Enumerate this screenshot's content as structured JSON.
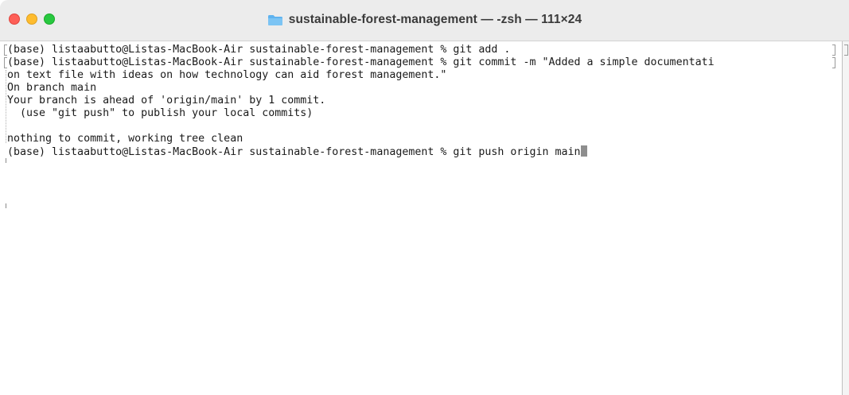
{
  "window": {
    "title": "sustainable-forest-management — -zsh — 111×24"
  },
  "traffic_lights": {
    "close_color": "#fe5f57",
    "minimize_color": "#febc2e",
    "maximize_color": "#28c840"
  },
  "terminal": {
    "lines": [
      "(base) listaabutto@Listas-MacBook-Air sustainable-forest-management % git add .",
      "(base) listaabutto@Listas-MacBook-Air sustainable-forest-management % git commit -m \"Added a simple documentati",
      "on text file with ideas on how technology can aid forest management.\"",
      "On branch main",
      "Your branch is ahead of 'origin/main' by 1 commit.",
      "  (use \"git push\" to publish your local commits)",
      "",
      "nothing to commit, working tree clean",
      "(base) listaabutto@Listas-MacBook-Air sustainable-forest-management % git push origin main"
    ]
  },
  "icons": {
    "title_icon": "folder-icon",
    "cursor": "block-cursor"
  }
}
